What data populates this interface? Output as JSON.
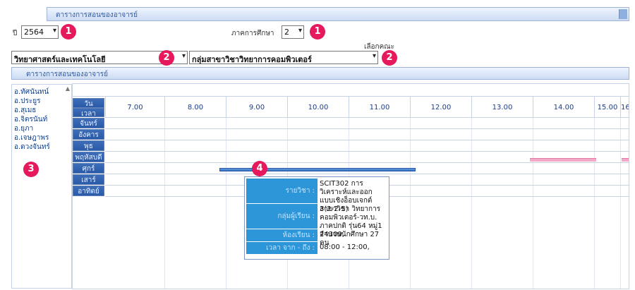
{
  "header": {
    "title": "ตารางการสอนของอาจารย์"
  },
  "filters": {
    "year_label": "ปี",
    "year_value": "2564",
    "term_label": "ภาคการศึกษา",
    "term_value": "2",
    "faculty_hint": "เลือกคณะ",
    "faculty_value": "วิทยาศาสตร์และเทคโนโลยี",
    "department_value": "กลุ่มสาขาวิชาวิทยาการคอมพิวเตอร์"
  },
  "markers": [
    "1",
    "1",
    "2",
    "2",
    "3",
    "4"
  ],
  "subheader": {
    "title": "ตารางการสอนของอาจารย์"
  },
  "teachers": [
    "อ.ทัศนันทน์",
    "อ.ประยูร",
    "อ.สุเมธ",
    "อ.จิตรนันท์",
    "อ.ยุภา",
    "อ.เจษฎาพร",
    "อ.ดวงจันทร์"
  ],
  "schedule": {
    "day_label": "วัน",
    "time_label": "เวลา",
    "times": [
      "7.00",
      "8.00",
      "9.00",
      "10.00",
      "11.00",
      "12.00",
      "13.00",
      "14.00",
      "15.00",
      "16."
    ],
    "days": [
      "จันทร์",
      "อังคาร",
      "พุธ",
      "พฤหัสบดี",
      "ศุกร์",
      "เสาร์",
      "อาทิตย์"
    ]
  },
  "tooltip": {
    "subject_label": "รายวิชา :",
    "subject_value": "SCIT302 การวิเคราะห์และออกแบบเชิงอ็อบเจกต์ 3(2-2-5)",
    "group_label": "กลุ่มผู้เรียน :",
    "group_value": "สาขาวิชา วิทยาการคอมพิวเตอร์-วท.บ. ภาคปกติ รุ่น64 หมู่1 จำนวนนักศึกษา 27 คน",
    "room_label": "ห้องเรียน :",
    "room_value": "24309,",
    "time_label": "เวลา จาก - ถึง :",
    "time_value": "08:00 - 12:00,"
  },
  "colors": {
    "accent": "#2a5aa8",
    "marker": "#e6195c",
    "pink_bar": "#f4a9c8",
    "tooltip_key": "#2d96d8"
  }
}
